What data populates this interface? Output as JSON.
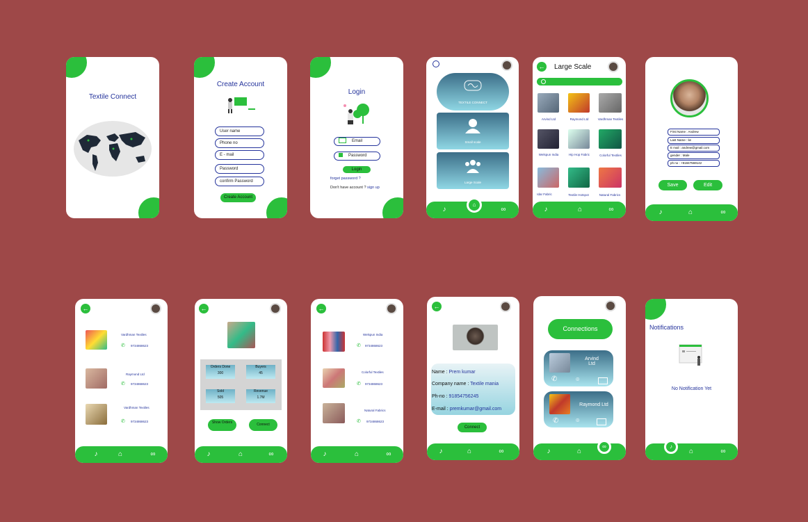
{
  "colors": {
    "background": "#9e4848",
    "accent": "#2bbf3c",
    "navy": "#23329b"
  },
  "splash": {
    "title": "Textile Connect"
  },
  "create": {
    "title": "Create Account",
    "fields": [
      "User name",
      "Phone no",
      "E - mail",
      "Password",
      "confirm Password"
    ],
    "button": "Create Account"
  },
  "login": {
    "title": "Login",
    "email": "Email",
    "password": "Password",
    "button": "Login",
    "forgot": "forget password ?",
    "no_account": "Don't have account ?",
    "signup": "sign up"
  },
  "home": {
    "tiles": [
      "TEXTILE CONNECT",
      "Small scale",
      "Large Scale"
    ]
  },
  "large": {
    "title": "Large Scale",
    "items": [
      "Arvind Ltd",
      "Raymond Ltd",
      "Vardhman Textiles",
      "Welspun India",
      "Hip Hop Fabric",
      "Colorful Textiles",
      "Idar Fabric",
      "Textile Hotspot",
      "Natural Fabrics"
    ]
  },
  "profile": {
    "fields": [
      {
        "k": "First Name :",
        "v": "Andrew"
      },
      {
        "k": "Last Name :",
        "v": "lie"
      },
      {
        "k": "E mail :",
        "v": "andrew@gmail.com"
      },
      {
        "k": "gender :",
        "v": "Male"
      },
      {
        "k": "ph no :",
        "v": "+91847569142"
      }
    ],
    "save": "Save",
    "edit": "Edit"
  },
  "list1": {
    "items": [
      {
        "name": "Vardhman Textiles",
        "phone": "9734868623"
      },
      {
        "name": "Raymond Ltd",
        "phone": "9734868623"
      },
      {
        "name": "Vardhman Textiles",
        "phone": "9734868623"
      }
    ]
  },
  "orders": {
    "stats": [
      {
        "label": "Orders Done",
        "value": "300"
      },
      {
        "label": "Buyers",
        "value": "45"
      },
      {
        "label": "Sold",
        "value": "505"
      },
      {
        "label": "Revenue",
        "value": "1.7M"
      }
    ],
    "show": "Show Orders",
    "connect": "Connect"
  },
  "list2": {
    "items": [
      {
        "name": "Welspun India",
        "phone": "9734868623"
      },
      {
        "name": "Colorful Textiles",
        "phone": "9734868623"
      },
      {
        "name": "Natural Fabrics",
        "phone": "9734868623"
      }
    ]
  },
  "detail": {
    "name_k": "Name :",
    "name_v": "Prem kumar",
    "company_k": "Company name :",
    "company_v": "Textile mania",
    "ph_k": "Ph-no :",
    "ph_v": "91854756245",
    "email_k": "E-mail :",
    "email_v": "premkumar@gmail.com",
    "button": "Connect"
  },
  "connections": {
    "title": "Connections",
    "items": [
      "Arvind Ltd",
      "Raymond Ltd"
    ]
  },
  "notifications": {
    "title": "Notifications",
    "empty": "No Notification Yet"
  }
}
